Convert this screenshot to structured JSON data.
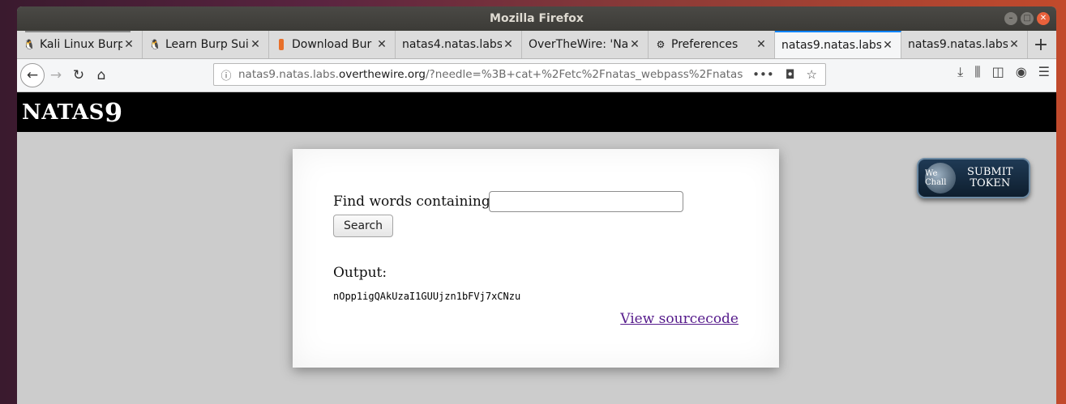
{
  "window": {
    "title": "Mozilla Firefox"
  },
  "tabs": [
    {
      "title": "Kali Linux Burp",
      "favicon": "penguin-icon"
    },
    {
      "title": "Learn Burp Sui",
      "favicon": "penguin-icon"
    },
    {
      "title": "Download Bur",
      "favicon": "burp-icon"
    },
    {
      "title": "natas4.natas.labs"
    },
    {
      "title": "OverTheWire: 'Na"
    },
    {
      "title": "Preferences",
      "favicon": "gear-icon"
    },
    {
      "title": "natas9.natas.labs"
    },
    {
      "title": "natas9.natas.labs"
    }
  ],
  "active_tab_index": 6,
  "url": {
    "prefix": "natas9.natas.labs.",
    "domain": "overthewire.org",
    "path": "/?needle=%3B+cat+%2Fetc%2Fnatas_webpass%2Fnatas"
  },
  "page": {
    "header_prefix": "NATAS",
    "header_number": "9",
    "find_label": "Find words containing:",
    "search_button": "Search",
    "output_label": "Output:",
    "output_value": "nOpp1igQAkUzaI1GUUjzn1bFVj7xCNzu",
    "source_link": "View sourcecode",
    "submit_token_line1": "SUBMIT",
    "submit_token_line2": "TOKEN",
    "wechall_logo_text": "We Chall"
  },
  "colors": {
    "accent": "#0a84ff",
    "link_visited": "#551a8b",
    "header_bg": "#000000"
  }
}
